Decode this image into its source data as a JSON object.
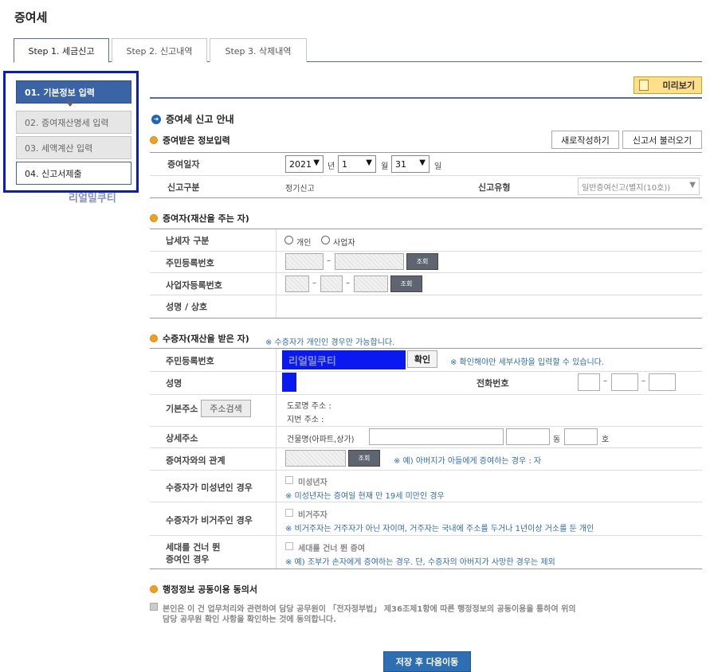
{
  "page_title": "증여세",
  "tabs": [
    {
      "label": "Step 1. 세금신고"
    },
    {
      "label": "Step 2. 신고내역"
    },
    {
      "label": "Step 3. 삭제내역"
    }
  ],
  "steps": [
    {
      "label": "01. 기본정보 입력"
    },
    {
      "label": "02. 증여재산명세 입력"
    },
    {
      "label": "03. 세액계산 입력"
    },
    {
      "label": "04. 신고서제출"
    }
  ],
  "watermark": "리얼밀쿠티",
  "preview_button": "미리보기",
  "guide_title": "증여세 신고 안내",
  "section_received": {
    "title": "증여받은 정보입력",
    "new_button": "새로작성하기",
    "load_button": "신고서 불러오기",
    "date_label": "증여일자",
    "year": "2021",
    "year_unit": "년",
    "month": "1",
    "month_unit": "월",
    "day": "31",
    "day_unit": "일",
    "type_label": "신고구분",
    "type_value": "정기신고",
    "form_label": "신고유형",
    "form_value": "일반증여신고(별지(10호))"
  },
  "section_donor": {
    "title": "증여자(재산을 주는 자)",
    "taxpayer_label": "납세자 구분",
    "opt_person": "개인",
    "opt_business": "사업자",
    "rrn_label": "주민등록번호",
    "brn_label": "사업자등록번호",
    "name_label": "성명 / 상호",
    "lookup": "조회",
    "dash": "–"
  },
  "section_recipient": {
    "title": "수증자(재산을 받은 자)",
    "note": "※ 수증자가 개인인 경우만 가능합니다.",
    "rrn_label": "주민등록번호",
    "rrn_value": "리얼밀쿠티",
    "confirm_button": "확인",
    "confirm_note": "※ 확인해야만 세부사항을 입력할 수 있습니다.",
    "name_label": "성명",
    "phone_label": "전화번호",
    "address_label": "기본주소",
    "address_search": "주소검색",
    "road_address": "도로명 주소 :",
    "lot_address": "지번 주소 :",
    "detail_label": "상세주소",
    "building_label": "건물명(아파트,상가)",
    "dong": "동",
    "ho": "호",
    "relation_label": "증여자와의 관계",
    "relation_lookup": "조회",
    "relation_note": "※ 예) 아버지가 아들에게 증여하는 경우 : 자",
    "minor_label": "수증자가 미성년인 경우",
    "minor_check": "미성년자",
    "minor_note": "※ 미성년자는 증여일 현재 만 19세 미만인 경우",
    "nonres_label": "수증자가 비거주인 경우",
    "nonres_check": "비거주자",
    "nonres_note": "※ 비거주자는 거주자가 아닌 자이며, 거주자는 국내에 주소를 두거나 1년이상 거소를 둔 개인",
    "skip_label_1": "세대를 건너 뛴",
    "skip_label_2": "증여인 경우",
    "skip_check": "세대를 건너 뛴 증여",
    "skip_note": "※ 예) 조부가 손자에게 증여하는 경우. 단, 수증자의 아버지가 사망한 경우는 제외"
  },
  "section_consent": {
    "title": "행정정보 공동이용 동의서",
    "line1": "본인은 이 건 업무처리와 관련하여 담당 공무원이 「전자정부법」 제36조제1항에 따른 행정정보의 공동이용을 통하여 위의",
    "line2": "담당 공무원 확인 사항을 확인하는 것에 동의합니다."
  },
  "submit_button": "저장 후 다음이동",
  "colors": {
    "primary": "#3a64a6",
    "highlight_box": "#0a1bc9",
    "accent": "#f0a020"
  }
}
